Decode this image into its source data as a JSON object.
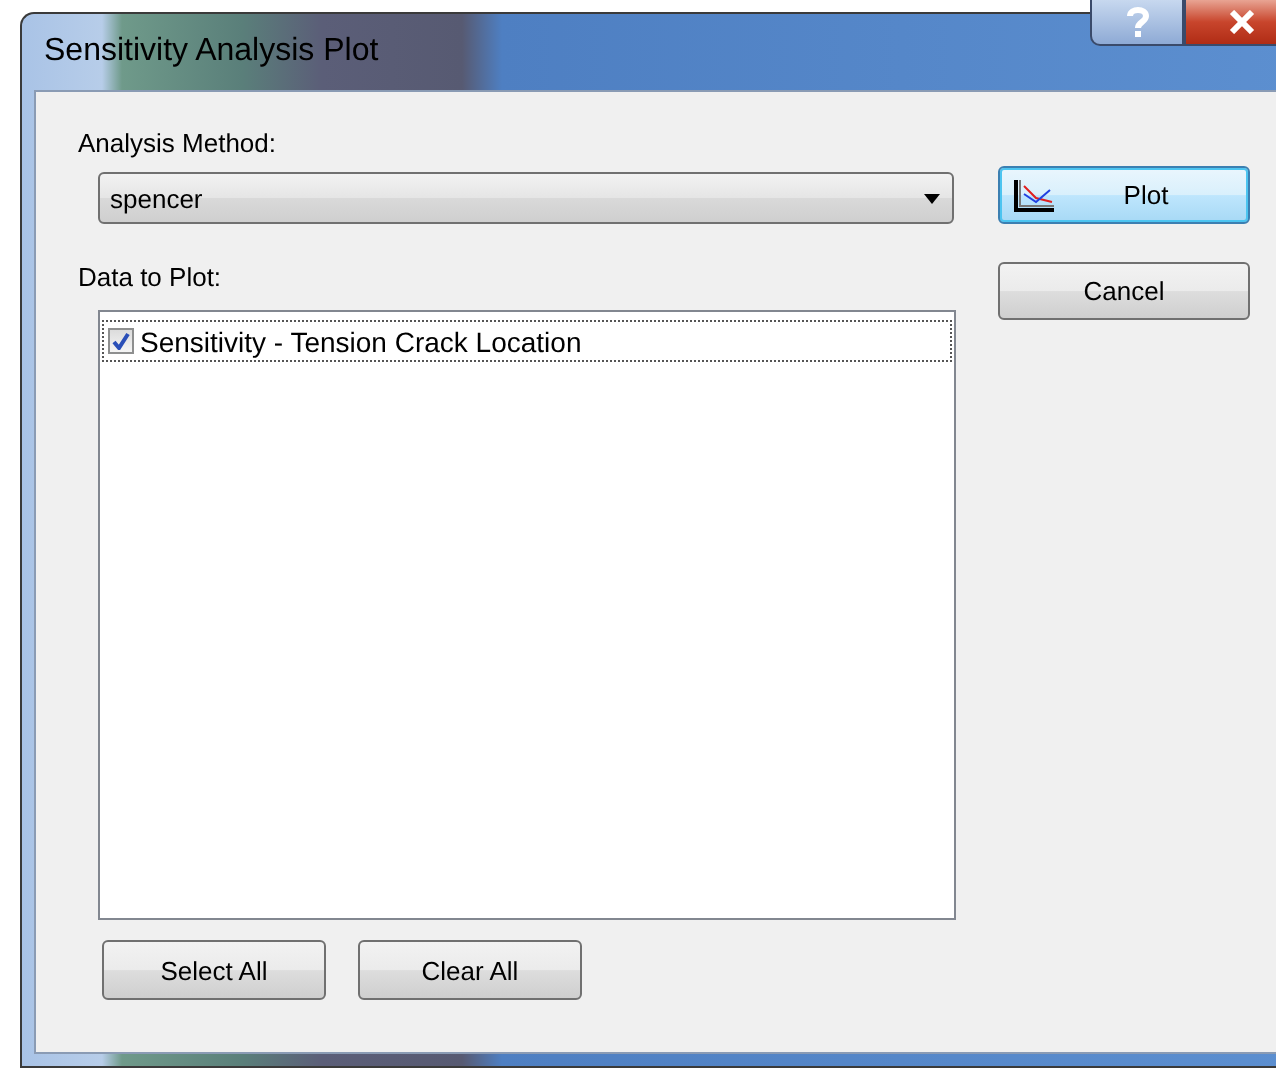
{
  "window": {
    "title": "Sensitivity Analysis Plot"
  },
  "analysis_method": {
    "label": "Analysis Method:",
    "value": "spencer"
  },
  "data_to_plot": {
    "label": "Data to Plot:",
    "items": [
      {
        "label": "Sensitivity - Tension Crack Location",
        "checked": true,
        "selected": true
      }
    ]
  },
  "buttons": [
    {
      "kind": "plot",
      "label": "Plot",
      "default": true
    },
    {
      "kind": "cancel",
      "label": "Cancel",
      "default": false
    },
    {
      "kind": "select",
      "label": "Select All",
      "default": false
    },
    {
      "kind": "clear",
      "label": "Clear All",
      "default": false
    }
  ]
}
